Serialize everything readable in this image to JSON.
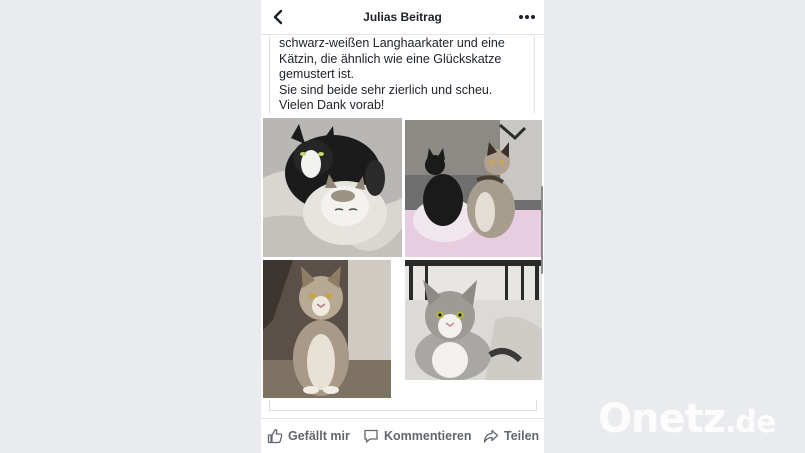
{
  "header": {
    "title": "Julias Beitrag",
    "back_icon": "chevron-left-icon",
    "more_icon": "more-horizontal-icon"
  },
  "post": {
    "lines": [
      "schwarz-weißen Langhaarkater und eine",
      "Kätzin, die ähnlich wie eine Glückskatze",
      "gemustert ist.",
      "Sie sind beide sehr zierlich und scheu.",
      "Vielen Dank vorab!"
    ]
  },
  "actions": {
    "like": "Gefällt mir",
    "comment": "Kommentieren",
    "share": "Teilen"
  },
  "watermark": {
    "brand": "Onetz",
    "tld": ".de"
  },
  "colors": {
    "background": "#e9ebee",
    "text": "#1d2129",
    "action_text": "#606770"
  }
}
